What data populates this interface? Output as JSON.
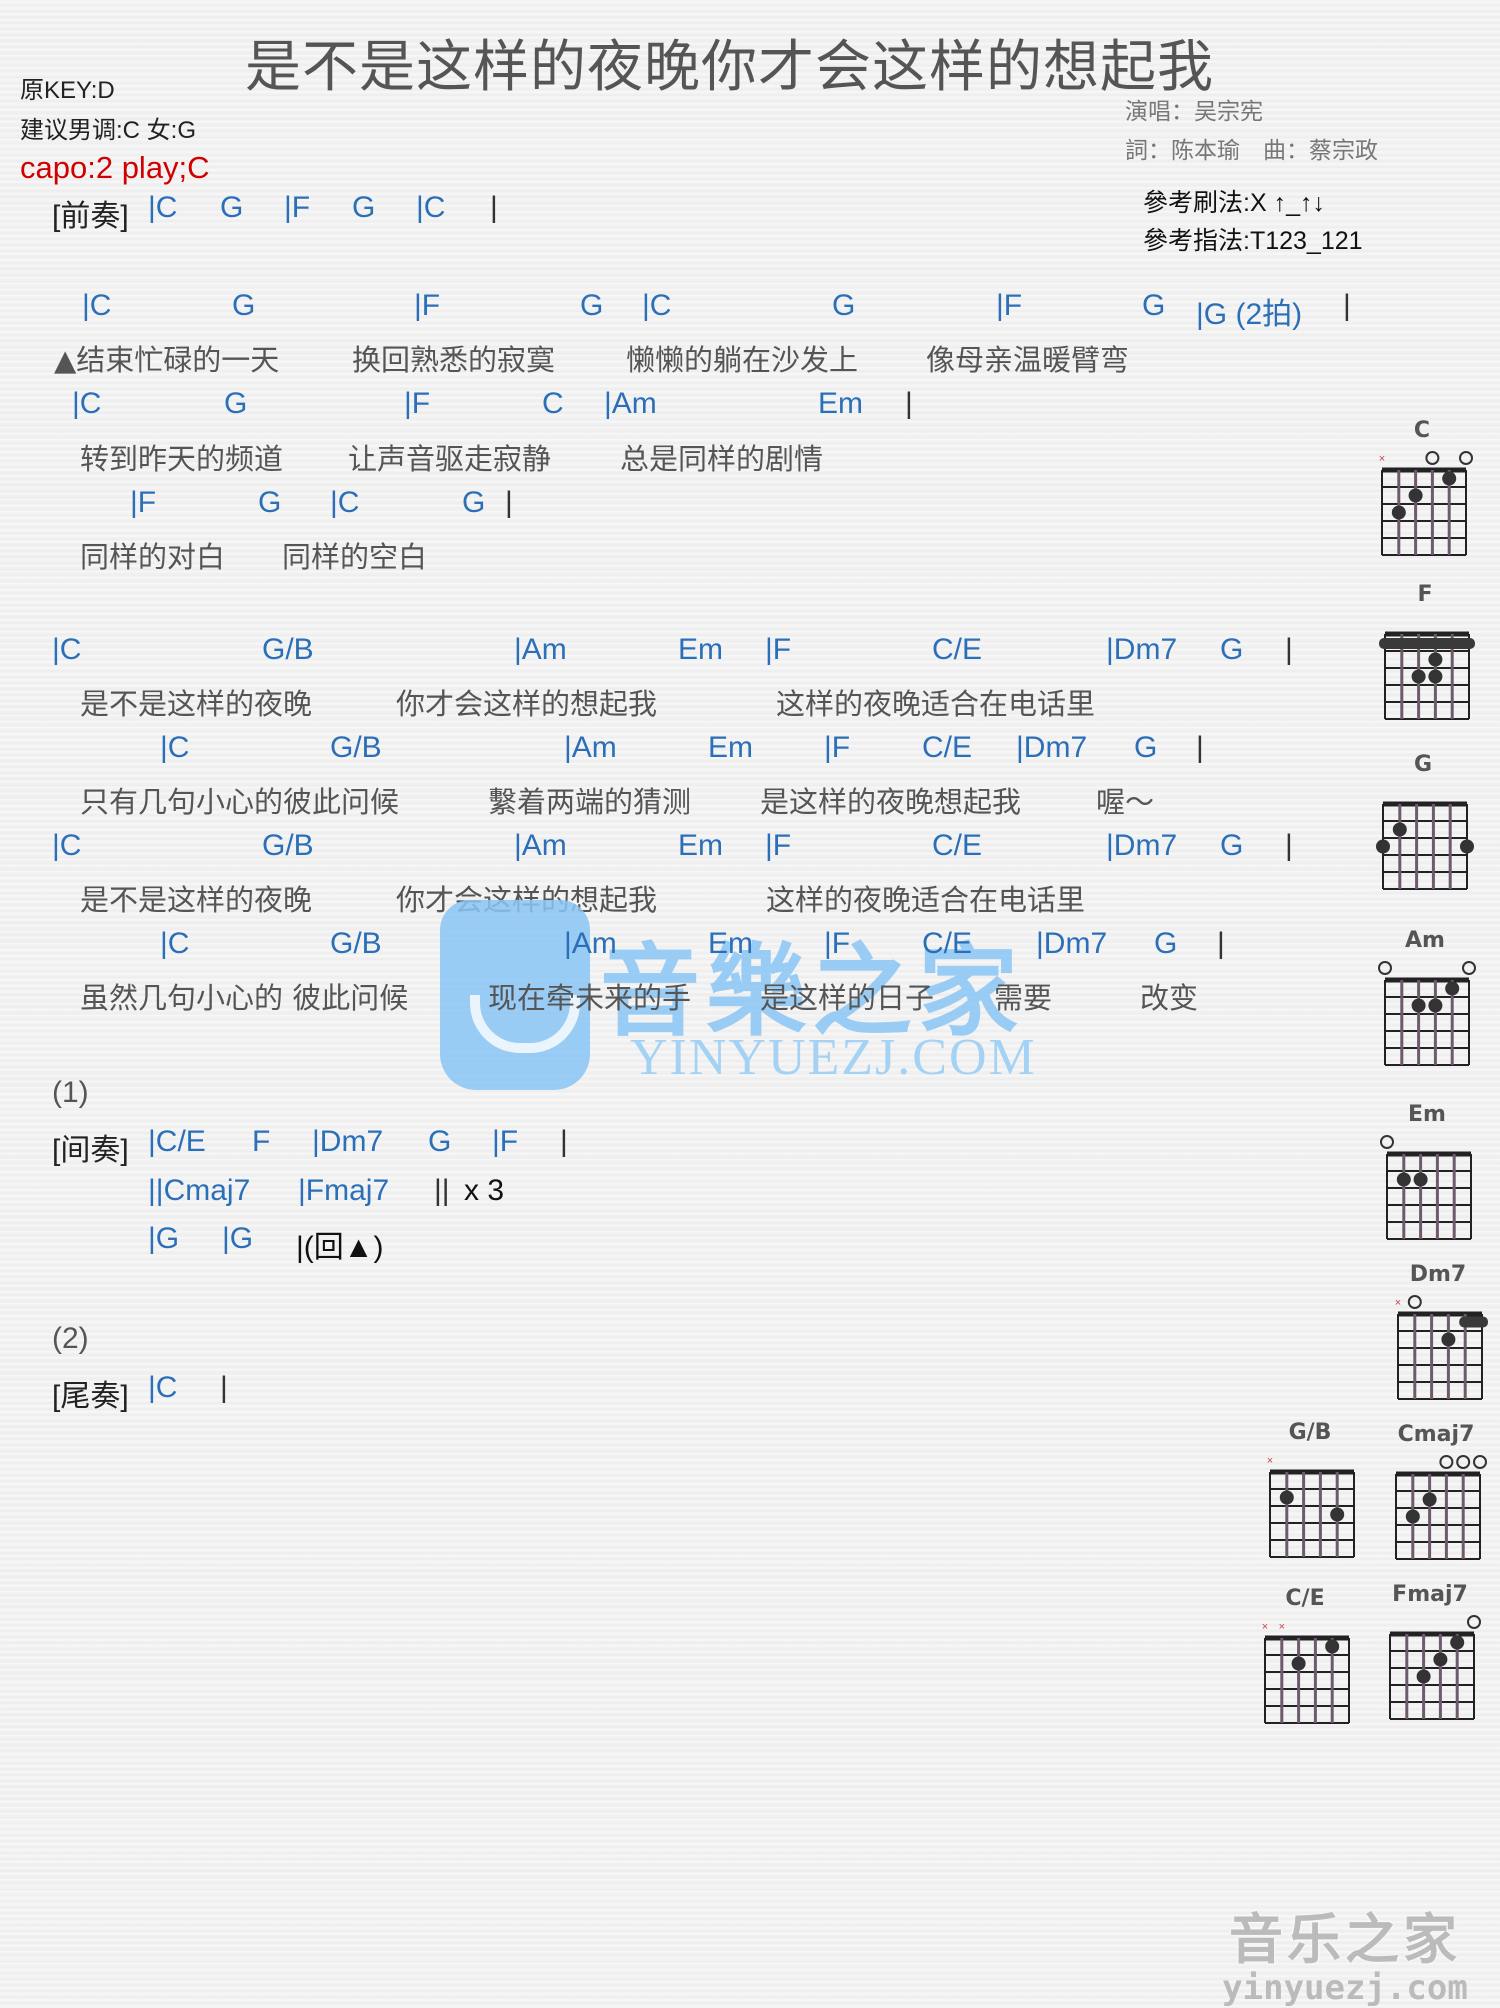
{
  "header": {
    "title": "是不是这样的夜晚你才会这样的想起我",
    "original_key": "原KEY:D",
    "suggested_key": "建议男调:C 女:G",
    "capo": "capo:2 play;C",
    "singer": "演唱：吴宗宪",
    "credits": "詞：陈本瑜　曲：蔡宗政",
    "strum": "參考刷法:X ↑_↑↓",
    "picking": "參考指法:T123_121"
  },
  "intro": {
    "label": "[前奏]",
    "chords": [
      "|C",
      "G",
      "|F",
      "G",
      "|C",
      "|"
    ]
  },
  "verse": [
    {
      "chords": [
        "|C",
        "G",
        "|F",
        "G",
        "|C",
        "G",
        "|F",
        "G",
        "|G (2拍)",
        "|"
      ],
      "lyrics": [
        "▲结束忙碌的一天",
        "换回熟悉的寂寞",
        "懒懒的躺在沙发上",
        "像母亲温暖臂弯"
      ]
    },
    {
      "chords": [
        "|C",
        "G",
        "|F",
        "C",
        "|Am",
        "Em",
        "|"
      ],
      "lyrics": [
        "转到昨天的频道",
        "让声音驱走寂静",
        "总是同样的剧情"
      ]
    },
    {
      "chords": [
        "|F",
        "G",
        "|C",
        "G",
        "|"
      ],
      "lyrics": [
        "同样的对白",
        "同样的空白"
      ]
    }
  ],
  "chorus": [
    {
      "chords": [
        "|C",
        "G/B",
        "|Am",
        "Em",
        "|F",
        "C/E",
        "|Dm7",
        "G",
        "|"
      ],
      "lyrics": [
        "是不是这样的夜晚",
        "你才会这样的想起我",
        "这样的夜晚适合在电话里"
      ]
    },
    {
      "chords": [
        "|C",
        "G/B",
        "|Am",
        "Em",
        "|F",
        "C/E",
        "|Dm7",
        "G",
        "|"
      ],
      "lyrics": [
        "只有几句小心的彼此问候",
        "繫着两端的猜测",
        "是这样的夜晚想起我",
        "喔～"
      ]
    },
    {
      "chords": [
        "|C",
        "G/B",
        "|Am",
        "Em",
        "|F",
        "C/E",
        "|Dm7",
        "G",
        "|"
      ],
      "lyrics": [
        "是不是这样的夜晚",
        "你才会这样的想起我",
        "这样的夜晚适合在电话里"
      ]
    },
    {
      "chords": [
        "|C",
        "G/B",
        "|Am",
        "Em",
        "|F",
        "C/E",
        "|Dm7",
        "G",
        "|"
      ],
      "lyrics": [
        "虽然几句小心的 彼此问候",
        "现在牵未来的手",
        "是这样的日子",
        "需要",
        "改变"
      ]
    }
  ],
  "interlude": {
    "marker": "(1)",
    "label": "[间奏]",
    "line1": [
      "|C/E",
      "F",
      "|Dm7",
      "G",
      "|F",
      "|"
    ],
    "line2": [
      "||Cmaj7",
      "|Fmaj7",
      "||",
      "x 3"
    ],
    "line3": [
      "|G",
      "|G",
      "|(回▲)"
    ]
  },
  "outro": {
    "marker": "(2)",
    "label": "[尾奏]",
    "chords": [
      "|C",
      "|"
    ]
  },
  "chord_diagrams": [
    {
      "name": "C",
      "top": [
        "x",
        "",
        "",
        "o",
        "",
        "o"
      ],
      "dots": [
        [
          5,
          3
        ],
        [
          4,
          2
        ],
        [
          2,
          1
        ]
      ],
      "barre": null
    },
    {
      "name": "F",
      "top": [
        "",
        "",
        "",
        "",
        "",
        ""
      ],
      "dots": [
        [
          3,
          3
        ],
        [
          4,
          3
        ],
        [
          3,
          2
        ]
      ],
      "barre": 1
    },
    {
      "name": "G",
      "top": [
        "",
        "",
        "",
        "",
        "",
        ""
      ],
      "dots": [
        [
          6,
          3
        ],
        [
          5,
          2
        ],
        [
          1,
          3
        ]
      ],
      "barre": null
    },
    {
      "name": "Am",
      "top": [
        "o",
        "",
        "",
        "",
        "",
        "o"
      ],
      "dots": [
        [
          4,
          2
        ],
        [
          3,
          2
        ],
        [
          2,
          1
        ]
      ],
      "barre": null
    },
    {
      "name": "Em",
      "top": [
        "o",
        "",
        "",
        "",
        "",
        ""
      ],
      "dots": [
        [
          5,
          2
        ],
        [
          4,
          2
        ]
      ],
      "barre": null
    },
    {
      "name": "Dm7",
      "top": [
        "x",
        "o",
        "",
        "",
        "",
        ""
      ],
      "dots": [
        [
          3,
          2
        ]
      ],
      "barre": "1-2"
    },
    {
      "name": "G/B",
      "top": [
        "x",
        "",
        "",
        "",
        "",
        ""
      ],
      "dots": [
        [
          5,
          2
        ],
        [
          2,
          3
        ]
      ],
      "barre": null
    },
    {
      "name": "Cmaj7",
      "top": [
        "",
        "",
        "",
        "o",
        "o",
        "o"
      ],
      "dots": [
        [
          5,
          3
        ],
        [
          4,
          2
        ]
      ],
      "barre": null
    },
    {
      "name": "C/E",
      "top": [
        "x",
        "x",
        "",
        "",
        "",
        ""
      ],
      "dots": [
        [
          4,
          2
        ],
        [
          2,
          1
        ]
      ],
      "barre": null
    },
    {
      "name": "Fmaj7",
      "top": [
        "",
        "",
        "",
        "",
        "",
        "o"
      ],
      "dots": [
        [
          4,
          3
        ],
        [
          3,
          2
        ],
        [
          2,
          1
        ]
      ],
      "barre": null
    }
  ],
  "watermark": {
    "cn": "音樂之家",
    "en": "YINYUEZJ.COM"
  },
  "footer_logo": {
    "cn": "音乐之家",
    "en": "yinyuezj.com"
  }
}
